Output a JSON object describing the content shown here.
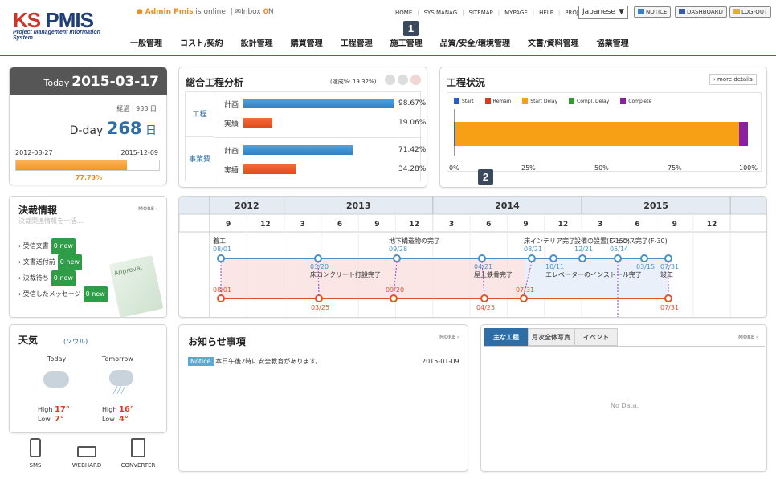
{
  "header": {
    "logo_main": "KS PMIS",
    "logo_sub": "Project Management Information System",
    "admin_name": "Admin Pmis",
    "admin_status": " is online",
    "inbox_label": "Inbox",
    "inbox_count": "0",
    "inbox_unit": "N",
    "toplinks": [
      "HOME",
      "SYS.MANAG",
      "SITEMAP",
      "MYPAGE",
      "HELP",
      "PROJECTS"
    ],
    "language": "Japanese",
    "btn_notice": "NOTICE",
    "btn_dashboard": "DASHBOARD",
    "btn_logout": "LOG-OUT",
    "nav": [
      "一般管理",
      "コスト/契約",
      "設計管理",
      "購買管理",
      "工程管理",
      "施工管理",
      "品質/安全/環境管理",
      "文書/資料管理",
      "協業管理"
    ],
    "badge1": "1",
    "badge2": "2"
  },
  "today": {
    "label": "Today",
    "date": "2015-03-17",
    "elapsed": "経過 : 933 日",
    "dday_label": "D-day",
    "dday_value": "268",
    "dday_unit": "日",
    "start": "2012-08-27",
    "end": "2015-12-09",
    "progress_text": "77.73%",
    "progress": 0.7773
  },
  "analysis": {
    "title": "総合工程分析",
    "rate": "(達成%: 19.32%)",
    "group1": "工程",
    "group2": "事業費",
    "row_plan": "計画",
    "row_actual": "実績",
    "values": [
      {
        "label": "計画",
        "pct": "98.67%",
        "v": 98.67,
        "color": "blue"
      },
      {
        "label": "実績",
        "pct": "19.06%",
        "v": 19.06,
        "color": "red"
      },
      {
        "label": "計画",
        "pct": "71.42%",
        "v": 71.42,
        "color": "blue"
      },
      {
        "label": "実績",
        "pct": "34.28%",
        "v": 34.28,
        "color": "red"
      }
    ]
  },
  "status": {
    "title": "工程状況",
    "more": "more details",
    "legend": [
      {
        "name": "Start",
        "color": "#2b5fb8"
      },
      {
        "name": "Remain",
        "color": "#d83b1f"
      },
      {
        "name": "Start Delay",
        "color": "#f7a015"
      },
      {
        "name": "Compl. Delay",
        "color": "#2f9c2f"
      },
      {
        "name": "Complete",
        "color": "#8b1fa0"
      }
    ],
    "ticks": [
      "0%",
      "25%",
      "50%",
      "75%",
      "100%"
    ],
    "chart_data": {
      "type": "bar",
      "categories": [
        ""
      ],
      "series": [
        {
          "name": "Start",
          "values": [
            0.5
          ]
        },
        {
          "name": "Start Delay",
          "values": [
            96.5
          ]
        },
        {
          "name": "Complete",
          "values": [
            3
          ]
        }
      ],
      "xlim": [
        0,
        100
      ]
    }
  },
  "approval": {
    "title": "決裁情報",
    "subtitle": "決裁関連情報を一括...",
    "more": "MORE",
    "items": [
      {
        "label": "受信文書",
        "badge": "0 new"
      },
      {
        "label": "文書送付前",
        "badge": "0 new"
      },
      {
        "label": "決裁待ち",
        "badge": "0 new"
      },
      {
        "label": "受信したメッセージ",
        "badge": "0 new"
      }
    ],
    "card_text": "Approval"
  },
  "timeline": {
    "years": [
      "2012",
      "2013",
      "2014",
      "2015"
    ],
    "months": [
      "9",
      "12",
      "3",
      "6",
      "9",
      "12",
      "3",
      "6",
      "9",
      "12",
      "3",
      "6",
      "9",
      "12"
    ],
    "plan_labels": [
      {
        "text": "着工",
        "date": "08/01"
      },
      {
        "text": "床コンクリート打設完了",
        "date": "03/20"
      },
      {
        "text": "地下構造物の完了",
        "date": "09/28"
      },
      {
        "text": "屋上鉄骨完了",
        "date": "04/21"
      },
      {
        "text": "床インテリア完了",
        "date": "08/21"
      },
      {
        "text": "エレベーターのインストール完了",
        "date": "10/11"
      },
      {
        "text": "設備の設置(F-150)",
        "date": "12/21"
      },
      {
        "text": "フェンス完了(F-30)",
        "date": "05/14"
      },
      {
        "text": "",
        "date": "03/15"
      },
      {
        "text": "竣工",
        "date": "07/31"
      }
    ],
    "actual_dates": [
      "08/01",
      "03/25",
      "09/20",
      "04/25",
      "07/31",
      "07/31"
    ]
  },
  "weather": {
    "title": "天気",
    "city": "(ソウル)",
    "today": "Today",
    "tomorrow": "Tomorrow",
    "high": "High",
    "low": "Low",
    "today_high": "17°",
    "today_low": "7°",
    "tom_high": "16°",
    "tom_low": "4°"
  },
  "tools": [
    "SMS",
    "WEBHARD",
    "CONVERTER"
  ],
  "notice": {
    "title": "お知らせ事項",
    "more": "MORE",
    "tag": "Notice",
    "text": "本日午後2時に安全教育があります。",
    "date": "2015-01-09"
  },
  "works": {
    "tabs": [
      "主な工程",
      "月次全体写真",
      "イベント"
    ],
    "more": "MORE",
    "empty": "No Data."
  }
}
